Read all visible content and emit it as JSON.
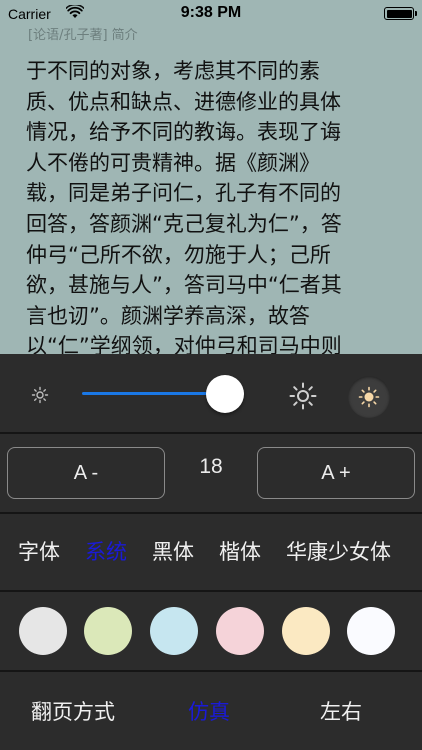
{
  "status_bar": {
    "carrier": "Carrier",
    "time": "9:38 PM",
    "battery_level": 1.0
  },
  "reader": {
    "header": "[论语/孔子著] 简介",
    "lines": [
      "于不同的对象，考虑其不同的素",
      "质、优点和缺点、进德修业的具体",
      "情况，给予不同的教诲。表现了诲",
      "人不倦的可贵精神。据《颜渊》",
      "载，同是弟子问仁，孔子有不同的",
      "回答，答颜渊“克己复礼为仁”，答",
      "仲弓“己所不欲，勿施于人；己所",
      "欲，甚施与人”，答司马中“仁者其",
      "言也讱”。颜渊学养高深，故答",
      "以“仁”学纲领，对仲弓和司马中则"
    ],
    "background": "#9fb6b4"
  },
  "brightness": {
    "level": 0.88,
    "low_icon": "sun-small-icon",
    "high_icon": "sun-large-icon",
    "night_icon": "sun-warm-icon",
    "accent": "#1a78e6"
  },
  "font_size": {
    "decrease_label": "A -",
    "value": "18",
    "increase_label": "A +"
  },
  "fonts": {
    "options": [
      "字体",
      "系统",
      "黑体",
      "楷体",
      "华康少女体"
    ],
    "selected": "系统",
    "selected_color": "#1a1ad8"
  },
  "backgrounds": {
    "colors": [
      "#e6e6e6",
      "#dbe8b9",
      "#c6e6f0",
      "#f5d3d9",
      "#fbe9c2",
      "#fafbff"
    ]
  },
  "page_turn": {
    "label": "翻页方式",
    "options": [
      "仿真",
      "左右"
    ],
    "selected": "仿真"
  }
}
